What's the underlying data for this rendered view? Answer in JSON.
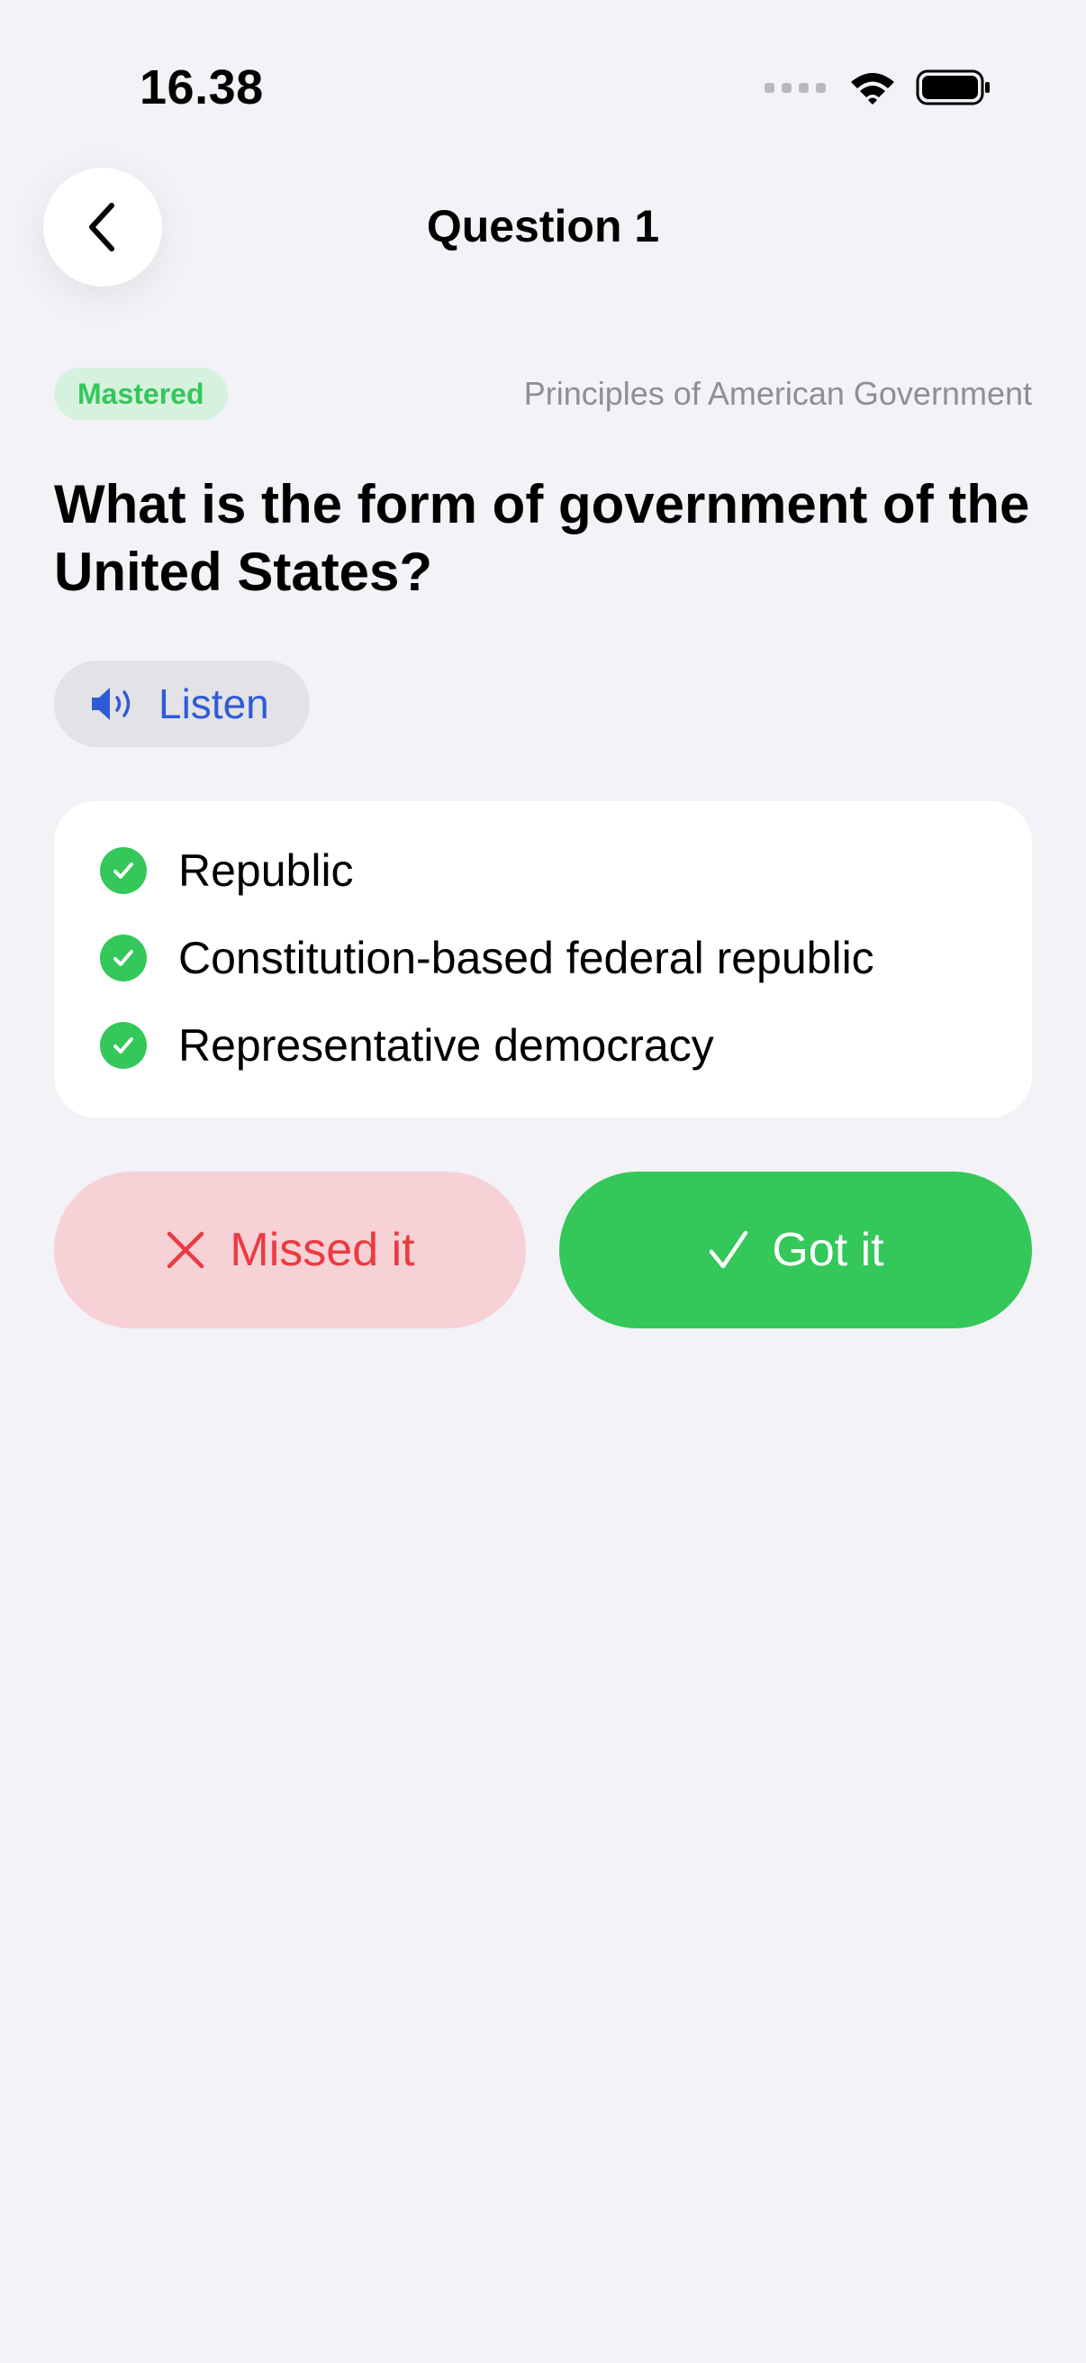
{
  "status_bar": {
    "time": "16.38",
    "icons": [
      "signal-dots-icon",
      "wifi-icon",
      "battery-icon"
    ]
  },
  "nav": {
    "back_icon": "chevron-left-icon",
    "title": "Question 1"
  },
  "question_card": {
    "status_badge": "Mastered",
    "category": "Principles of American Government",
    "question": "What is the form of government of the United States?",
    "listen": {
      "icon": "speaker-icon",
      "label": "Listen"
    },
    "answers": [
      {
        "text": "Republic",
        "icon": "checkmark-circle-icon"
      },
      {
        "text": "Constitution-based federal republic",
        "icon": "checkmark-circle-icon"
      },
      {
        "text": "Representative democracy",
        "icon": "checkmark-circle-icon"
      }
    ]
  },
  "actions": {
    "missed": {
      "label": "Missed it",
      "icon": "x-icon"
    },
    "got": {
      "label": "Got it",
      "icon": "checkmark-icon"
    }
  },
  "colors": {
    "background": "#F2F2F7",
    "accent_green": "#34C759",
    "badge_bg": "#D6F1DD",
    "listen_blue": "#2F5BD6",
    "missed_bg": "#F6D1D6",
    "missed_red": "#EC3A41",
    "secondary_text": "#8E8E93"
  }
}
